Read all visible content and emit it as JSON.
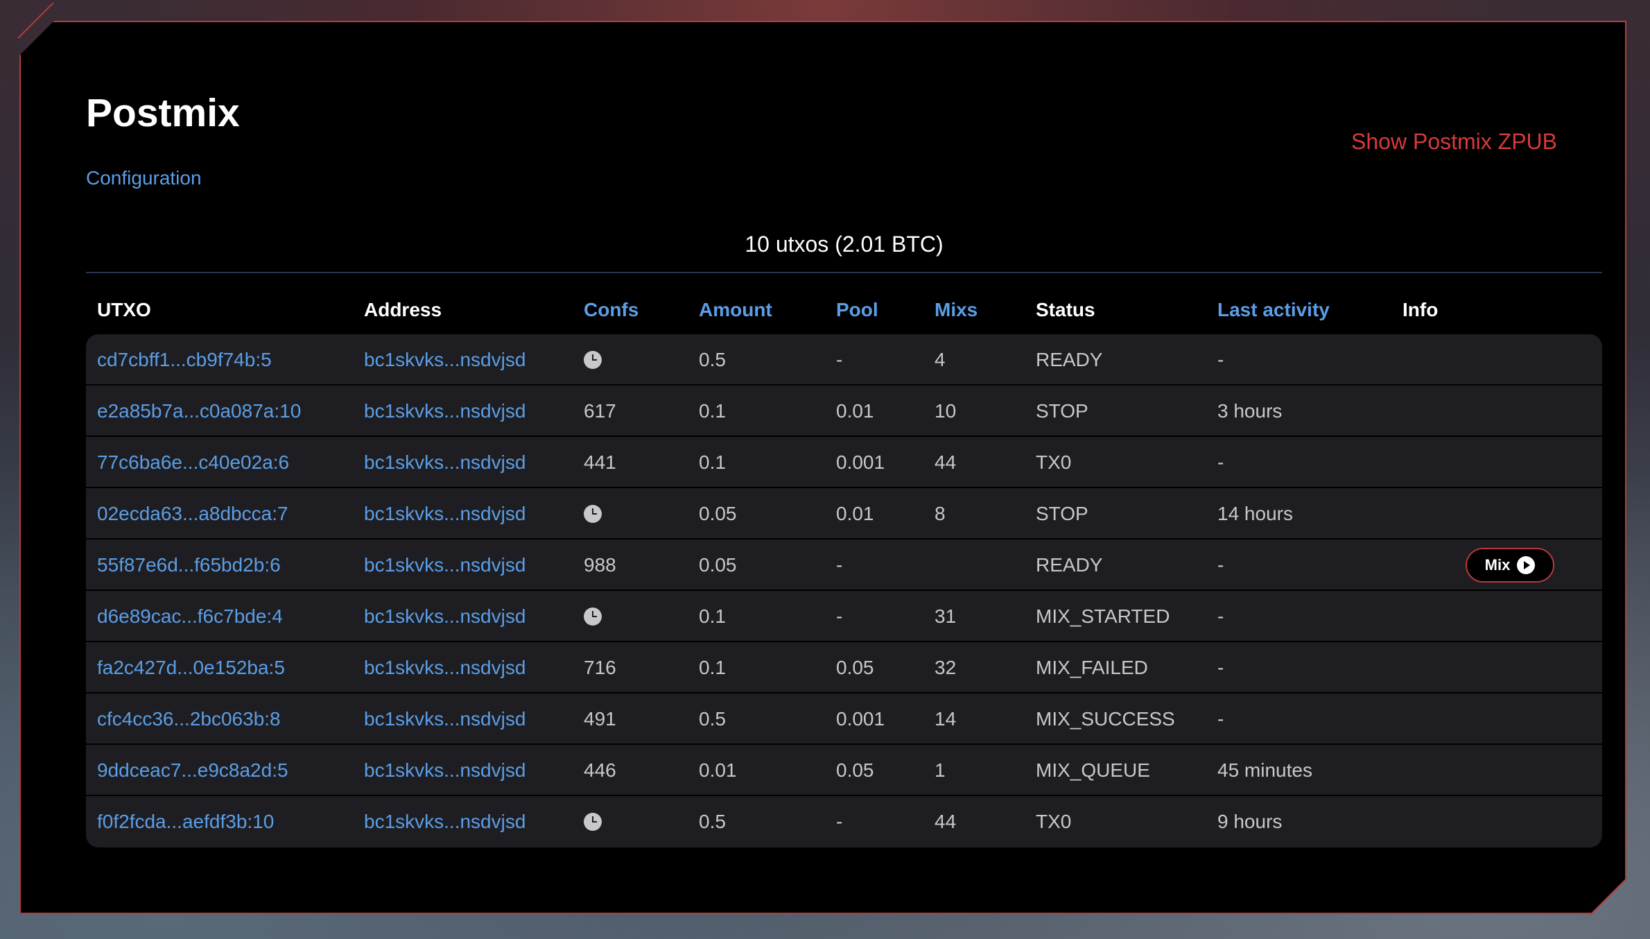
{
  "page": {
    "title": "Postmix",
    "configuration_label": "Configuration",
    "show_zpub_label": "Show Postmix ZPUB",
    "summary": "10 utxos (2.01 BTC)"
  },
  "table": {
    "headers": {
      "utxo": "UTXO",
      "address": "Address",
      "confs": "Confs",
      "amount": "Amount",
      "pool": "Pool",
      "mixs": "Mixs",
      "status": "Status",
      "last_activity": "Last activity",
      "info": "Info"
    },
    "mix_button_label": "Mix",
    "rows": [
      {
        "utxo": "cd7cbff1...cb9f74b:5",
        "address": "bc1skvks...nsdvjsd",
        "confs": "",
        "pending": true,
        "amount": "0.5",
        "pool": "-",
        "mixs": "4",
        "status": "READY",
        "last_activity": "-",
        "mix_button": false
      },
      {
        "utxo": "e2a85b7a...c0a087a:10",
        "address": "bc1skvks...nsdvjsd",
        "confs": "617",
        "pending": false,
        "amount": "0.1",
        "pool": "0.01",
        "mixs": "10",
        "status": "STOP",
        "last_activity": "3 hours",
        "mix_button": false
      },
      {
        "utxo": "77c6ba6e...c40e02a:6",
        "address": "bc1skvks...nsdvjsd",
        "confs": "441",
        "pending": false,
        "amount": "0.1",
        "pool": "0.001",
        "mixs": "44",
        "status": "TX0",
        "last_activity": "-",
        "mix_button": false
      },
      {
        "utxo": "02ecda63...a8dbcca:7",
        "address": "bc1skvks...nsdvjsd",
        "confs": "",
        "pending": true,
        "amount": "0.05",
        "pool": "0.01",
        "mixs": "8",
        "status": "STOP",
        "last_activity": "14 hours",
        "mix_button": false
      },
      {
        "utxo": "55f87e6d...f65bd2b:6",
        "address": "bc1skvks...nsdvjsd",
        "confs": "988",
        "pending": false,
        "amount": "0.05",
        "pool": "-",
        "mixs": "",
        "status": "READY",
        "last_activity": "-",
        "mix_button": true
      },
      {
        "utxo": "d6e89cac...f6c7bde:4",
        "address": "bc1skvks...nsdvjsd",
        "confs": "",
        "pending": true,
        "amount": "0.1",
        "pool": "-",
        "mixs": "31",
        "status": "MIX_STARTED",
        "last_activity": "-",
        "mix_button": false
      },
      {
        "utxo": "fa2c427d...0e152ba:5",
        "address": "bc1skvks...nsdvjsd",
        "confs": "716",
        "pending": false,
        "amount": "0.1",
        "pool": "0.05",
        "mixs": "32",
        "status": "MIX_FAILED",
        "last_activity": "-",
        "mix_button": false
      },
      {
        "utxo": "cfc4cc36...2bc063b:8",
        "address": "bc1skvks...nsdvjsd",
        "confs": "491",
        "pending": false,
        "amount": "0.5",
        "pool": "0.001",
        "mixs": "14",
        "status": "MIX_SUCCESS",
        "last_activity": "-",
        "mix_button": false
      },
      {
        "utxo": "9ddceac7...e9c8a2d:5",
        "address": "bc1skvks...nsdvjsd",
        "confs": "446",
        "pending": false,
        "amount": "0.01",
        "pool": "0.05",
        "mixs": "1",
        "status": "MIX_QUEUE",
        "last_activity": "45 minutes",
        "mix_button": false
      },
      {
        "utxo": "f0f2fcda...aefdf3b:10",
        "address": "bc1skvks...nsdvjsd",
        "confs": "",
        "pending": true,
        "amount": "0.5",
        "pool": "-",
        "mixs": "44",
        "status": "TX0",
        "last_activity": "9 hours",
        "mix_button": false
      }
    ]
  }
}
